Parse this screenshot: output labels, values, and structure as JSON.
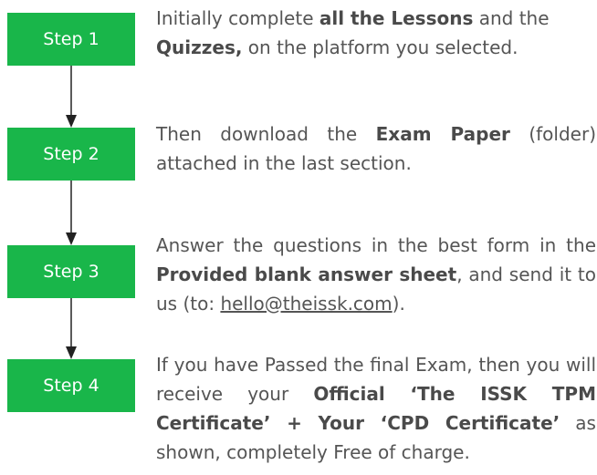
{
  "steps": [
    {
      "label": "Step 1",
      "segments": [
        {
          "text": "Initially complete ",
          "bold": false
        },
        {
          "text": "all the Lessons",
          "bold": true
        },
        {
          "text": " and the ",
          "bold": false
        },
        {
          "text": "Quizzes,",
          "bold": true
        },
        {
          "text": " on the platform you selected.",
          "bold": false
        }
      ]
    },
    {
      "label": "Step 2",
      "segments": [
        {
          "text": "Then download the ",
          "bold": false
        },
        {
          "text": "Exam Paper",
          "bold": true
        },
        {
          "text": " (folder) attached in the last section.",
          "bold": false
        }
      ]
    },
    {
      "label": "Step 3",
      "segments": [
        {
          "text": "Answer the questions in the best form in the ",
          "bold": false
        },
        {
          "text": "Provided blank answer sheet",
          "bold": true
        },
        {
          "text": ", and send it to us (to: ",
          "bold": false
        },
        {
          "text": "hello@theissk.com",
          "bold": false,
          "link": true
        },
        {
          "text": ").",
          "bold": false
        }
      ]
    },
    {
      "label": "Step 4",
      "segments": [
        {
          "text": "If you have Passed the final Exam, then you will receive your ",
          "bold": false
        },
        {
          "text": "Official ‘The ISSK TPM Certificate’ + Your ‘CPD Certificate’",
          "bold": true
        },
        {
          "text": " as shown, completely Free of charge.",
          "bold": false
        }
      ]
    }
  ],
  "colors": {
    "step_box": "#19b64a",
    "step_label": "#ffffff",
    "body_text": "#555555",
    "connector": "#222222"
  }
}
